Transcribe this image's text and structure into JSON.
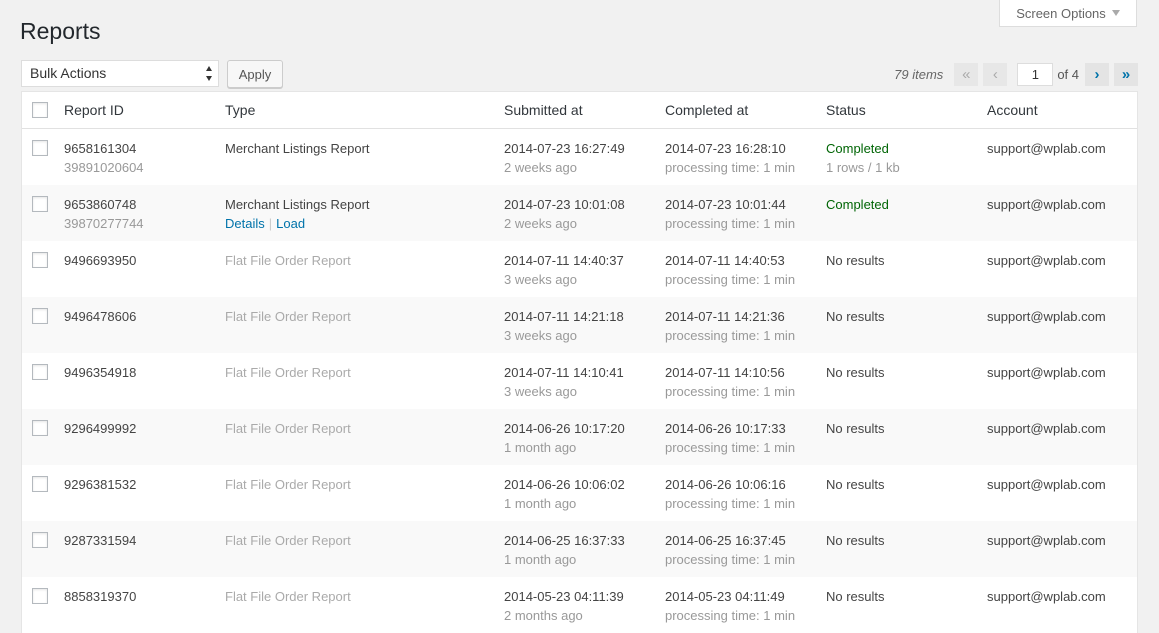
{
  "header": {
    "title": "Reports",
    "screen_options": "Screen Options"
  },
  "toolbar": {
    "bulk_actions": "Bulk Actions",
    "apply": "Apply",
    "items_count": "79 items",
    "current_page": "1",
    "of_total": "of 4",
    "first": "«",
    "prev": "‹",
    "next": "›",
    "last": "»"
  },
  "columns": {
    "report_id": "Report ID",
    "type": "Type",
    "submitted_at": "Submitted at",
    "completed_at": "Completed at",
    "status": "Status",
    "account": "Account"
  },
  "rows": [
    {
      "id": "9658161304",
      "sub_id": "39891020604",
      "type": "Merchant Listings Report",
      "type_active": true,
      "submitted": "2014-07-23 16:27:49",
      "submitted_ago": "2 weeks ago",
      "completed": "2014-07-23 16:28:10",
      "processing": "processing time: 1 min",
      "status": "Completed",
      "status_ok": true,
      "status_detail": "1 rows / 1 kb",
      "account": "support@wplab.com"
    },
    {
      "id": "9653860748",
      "sub_id": "39870277744",
      "type": "Merchant Listings Report",
      "type_active": true,
      "action_details": "Details",
      "action_load": "Load",
      "submitted": "2014-07-23 10:01:08",
      "submitted_ago": "2 weeks ago",
      "completed": "2014-07-23 10:01:44",
      "processing": "processing time: 1 min",
      "status": "Completed",
      "status_ok": true,
      "account": "support@wplab.com"
    },
    {
      "id": "9496693950",
      "type": "Flat File Order Report",
      "type_active": false,
      "submitted": "2014-07-11 14:40:37",
      "submitted_ago": "3 weeks ago",
      "completed": "2014-07-11 14:40:53",
      "processing": "processing time: 1 min",
      "status": "No results",
      "status_ok": false,
      "account": "support@wplab.com"
    },
    {
      "id": "9496478606",
      "type": "Flat File Order Report",
      "type_active": false,
      "submitted": "2014-07-11 14:21:18",
      "submitted_ago": "3 weeks ago",
      "completed": "2014-07-11 14:21:36",
      "processing": "processing time: 1 min",
      "status": "No results",
      "status_ok": false,
      "account": "support@wplab.com"
    },
    {
      "id": "9496354918",
      "type": "Flat File Order Report",
      "type_active": false,
      "submitted": "2014-07-11 14:10:41",
      "submitted_ago": "3 weeks ago",
      "completed": "2014-07-11 14:10:56",
      "processing": "processing time: 1 min",
      "status": "No results",
      "status_ok": false,
      "account": "support@wplab.com"
    },
    {
      "id": "9296499992",
      "type": "Flat File Order Report",
      "type_active": false,
      "submitted": "2014-06-26 10:17:20",
      "submitted_ago": "1 month ago",
      "completed": "2014-06-26 10:17:33",
      "processing": "processing time: 1 min",
      "status": "No results",
      "status_ok": false,
      "account": "support@wplab.com"
    },
    {
      "id": "9296381532",
      "type": "Flat File Order Report",
      "type_active": false,
      "submitted": "2014-06-26 10:06:02",
      "submitted_ago": "1 month ago",
      "completed": "2014-06-26 10:06:16",
      "processing": "processing time: 1 min",
      "status": "No results",
      "status_ok": false,
      "account": "support@wplab.com"
    },
    {
      "id": "9287331594",
      "type": "Flat File Order Report",
      "type_active": false,
      "submitted": "2014-06-25 16:37:33",
      "submitted_ago": "1 month ago",
      "completed": "2014-06-25 16:37:45",
      "processing": "processing time: 1 min",
      "status": "No results",
      "status_ok": false,
      "account": "support@wplab.com"
    },
    {
      "id": "8858319370",
      "type": "Flat File Order Report",
      "type_active": false,
      "submitted": "2014-05-23 04:11:39",
      "submitted_ago": "2 months ago",
      "completed": "2014-05-23 04:11:49",
      "processing": "processing time: 1 min",
      "status": "No results",
      "status_ok": false,
      "account": "support@wplab.com"
    }
  ]
}
